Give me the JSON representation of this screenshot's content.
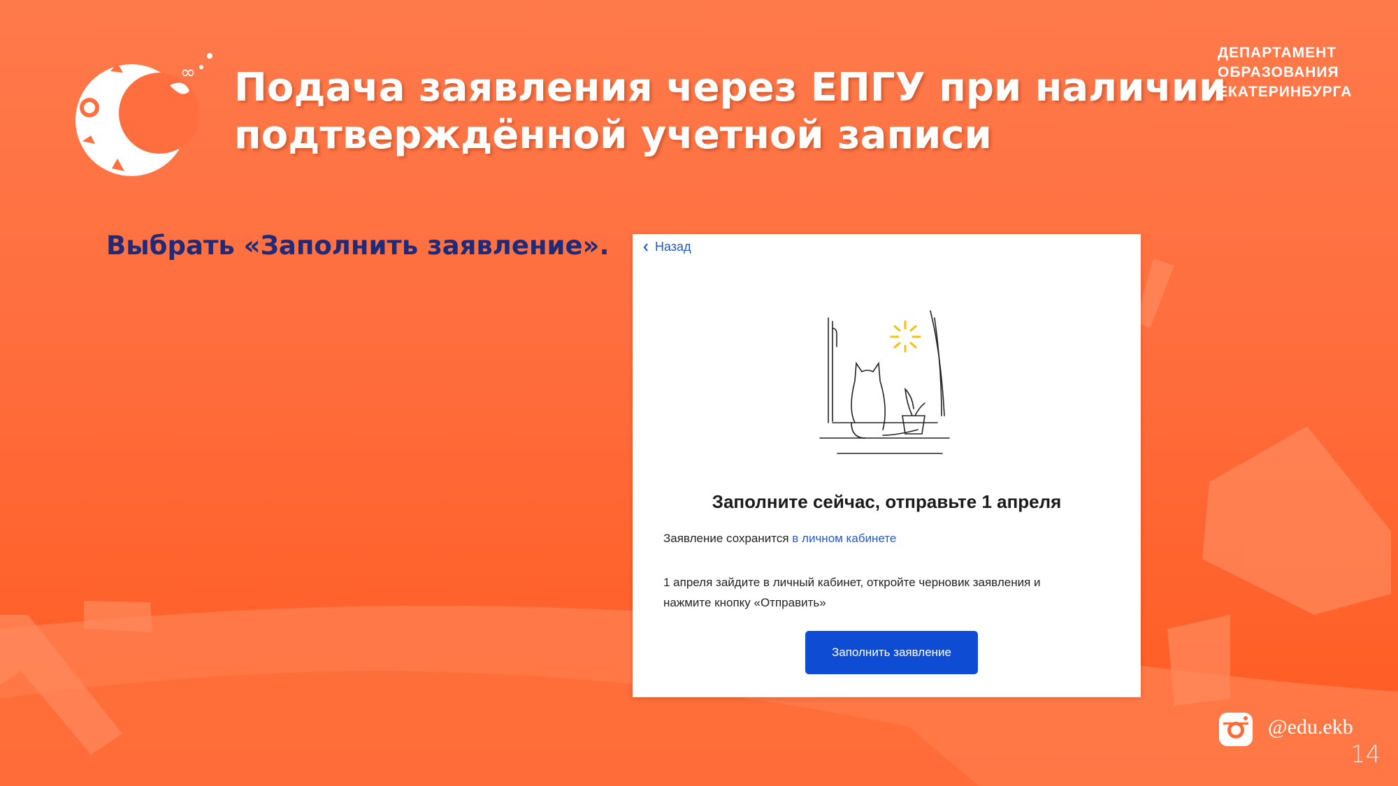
{
  "slide": {
    "title_line1": "Подача заявления через ЕПГУ при наличии",
    "title_line2": "подтверждённой учетной записи",
    "department": [
      "ДЕПАРТАМЕНТ",
      "ОБРАЗОВАНИЯ",
      "ЕКАТЕРИНБУРГА"
    ],
    "instruction": "Выбрать «Заполнить заявление».",
    "instagram_handle": "@edu.ekb",
    "page_number": "14"
  },
  "screenshot": {
    "back_label": "Назад",
    "heading": "Заполните сейчас, отправьте 1 апреля",
    "saved_text": "Заявление сохранится ",
    "saved_link": "в личном кабинете",
    "instruction_line1": "1 апреля зайдите в личный кабинет, откройте черновик заявления и",
    "instruction_line2": "нажмите кнопку «Отправить»",
    "button_label": "Заполнить заявление"
  },
  "colors": {
    "background": "#ff6a38",
    "title_text": "#ffffff",
    "instruction_text": "#1f2a78",
    "link": "#1d5ad6",
    "button": "#0d4cd3"
  },
  "icons": [
    "back-chevron-icon",
    "instagram-icon",
    "sun-icon"
  ]
}
